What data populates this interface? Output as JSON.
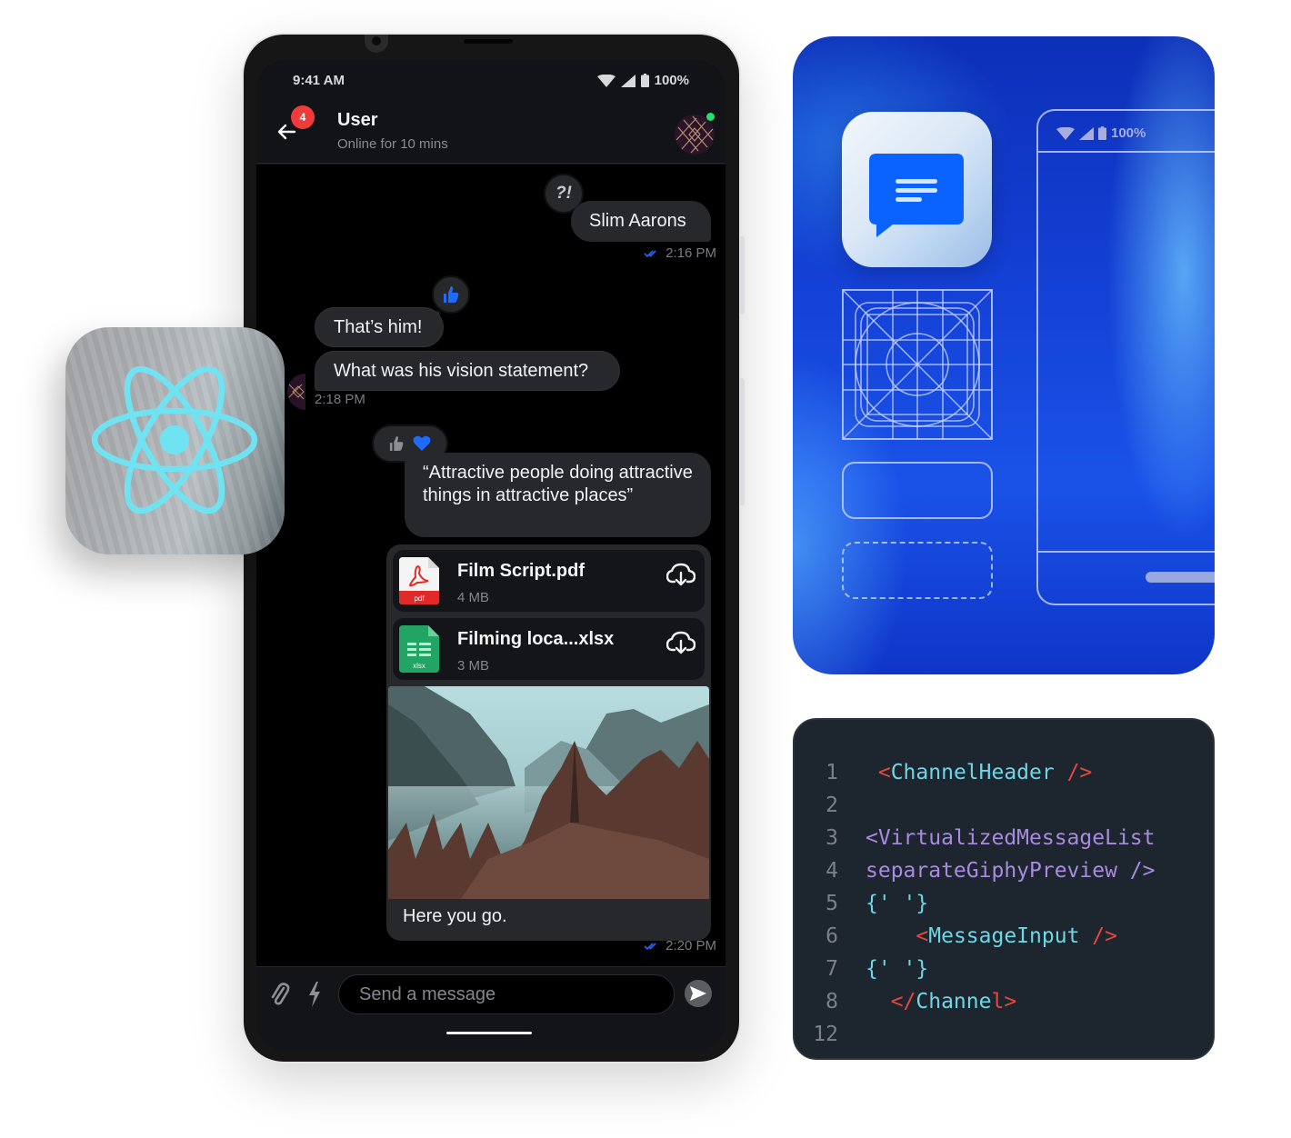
{
  "phone": {
    "status_bar": {
      "time": "9:41 AM",
      "battery": "100%"
    },
    "header": {
      "back_label": "Back",
      "unread_count": "4",
      "title": "User",
      "subtitle": "Online for 10 mins",
      "online": true
    },
    "messages": [
      {
        "id": "m1",
        "side": "right",
        "text": "Slim Aarons",
        "reaction": "?!",
        "time": "2:16 PM",
        "read": true
      },
      {
        "id": "m2",
        "side": "left",
        "text": "That’s him!",
        "reaction": "thumbs-up"
      },
      {
        "id": "m3",
        "side": "left",
        "text": "What was his vision statement?",
        "time": "2:18 PM"
      },
      {
        "id": "m4",
        "side": "right",
        "text": "“Attractive people doing attractive things in attractive places”",
        "reactions": [
          "thumbs-up",
          "heart"
        ]
      }
    ],
    "attachments": [
      {
        "name": "Film Script.pdf",
        "size": "4 MB",
        "type_label": "pdf",
        "type": "pdf"
      },
      {
        "name": "Filming loca...xlsx",
        "size": "3 MB",
        "type_label": "xlsx",
        "type": "xlsx"
      }
    ],
    "image_message": {
      "alt": "Foggy mountain valley with pine trees",
      "caption": "Here you go.",
      "time": "2:20 PM",
      "read": true
    },
    "composer": {
      "placeholder": "Send a message",
      "value": ""
    }
  },
  "design_card": {
    "wire_status_battery": "100%"
  },
  "code_card": {
    "lines": [
      {
        "num": "1",
        "tokens": [
          {
            "t": " <",
            "c": "red"
          },
          {
            "t": "ChannelHeader",
            "c": "cyan"
          },
          {
            "t": " />",
            "c": "red"
          }
        ]
      },
      {
        "num": "2",
        "tokens": []
      },
      {
        "num": "3",
        "tokens": [
          {
            "t": "<VirtualizedMessageList",
            "c": "purple"
          }
        ]
      },
      {
        "num": "4",
        "tokens": [
          {
            "t": "separateGiphyPreview />",
            "c": "purple"
          }
        ]
      },
      {
        "num": "5",
        "tokens": [
          {
            "t": "{' '}",
            "c": "cyan"
          }
        ]
      },
      {
        "num": "6",
        "tokens": [
          {
            "t": "    <",
            "c": "red"
          },
          {
            "t": "MessageInput",
            "c": "cyan"
          },
          {
            "t": " />",
            "c": "red"
          }
        ]
      },
      {
        "num": "7",
        "tokens": [
          {
            "t": "{' '}",
            "c": "cyan"
          }
        ]
      },
      {
        "num": "8",
        "tokens": [
          {
            "t": "  </",
            "c": "red"
          },
          {
            "t": "Channe",
            "c": "cyan"
          },
          {
            "t": "l>",
            "c": "red"
          }
        ]
      },
      {
        "num": "12",
        "tokens": []
      }
    ]
  },
  "colors": {
    "accent_blue": "#005fff",
    "unread_red": "#ef3b3b",
    "online_green": "#20e070",
    "react_cyan": "#6fe3f2",
    "bubble_bg": "#26282c"
  }
}
